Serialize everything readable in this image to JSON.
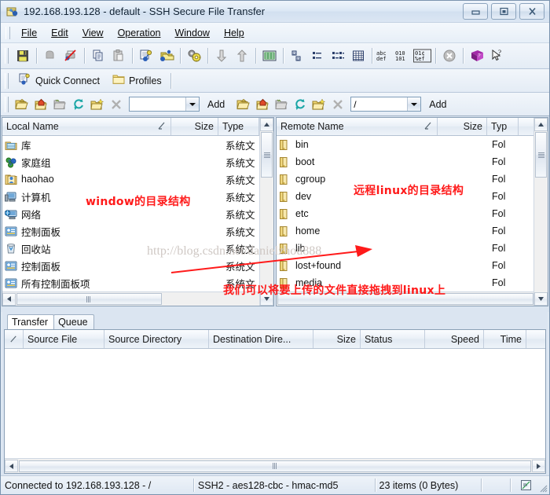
{
  "window": {
    "title": "192.168.193.128 - default - SSH Secure File Transfer",
    "icon": "app-icon",
    "buttons": {
      "minimize": "minimize-icon",
      "maximize": "maximize-icon",
      "close": "close-icon"
    }
  },
  "menu": [
    "File",
    "Edit",
    "View",
    "Operation",
    "Window",
    "Help"
  ],
  "toolbar": {
    "items": [
      {
        "name": "save-icon"
      },
      {
        "name": "print-icon"
      },
      {
        "name": "print-disabled-icon"
      },
      {
        "name": "copy-icon"
      },
      {
        "name": "paste-icon"
      },
      {
        "name": "new-connection-icon"
      },
      {
        "name": "new-file-transfer-icon"
      },
      {
        "name": "settings-icon"
      },
      {
        "name": "download-icon"
      },
      {
        "name": "upload-icon"
      },
      {
        "name": "show-hide-icon"
      },
      {
        "name": "view-large-icons-icon"
      },
      {
        "name": "view-small-icons-icon"
      },
      {
        "name": "view-list-icon"
      },
      {
        "name": "view-details-icon"
      },
      {
        "name": "ascii-transfer-icon"
      },
      {
        "name": "binary-transfer-icon"
      },
      {
        "name": "auto-transfer-icon"
      },
      {
        "name": "disconnect-icon"
      },
      {
        "name": "help-book-icon"
      },
      {
        "name": "context-help-icon"
      }
    ]
  },
  "quickbar": {
    "quick_connect": "Quick Connect",
    "profiles": "Profiles"
  },
  "pathbar": {
    "left": {
      "value": "",
      "placeholder": "",
      "add_label": "Add",
      "buttons": [
        "up-folder-icon",
        "home-folder-icon",
        "back-folder-icon",
        "refresh-icon",
        "new-folder-icon",
        "delete-icon"
      ]
    },
    "right": {
      "value": "/",
      "placeholder": "",
      "add_label": "Add",
      "buttons": [
        "up-folder-icon",
        "home-folder-icon",
        "back-folder-icon",
        "refresh-icon",
        "new-folder-icon",
        "delete-icon"
      ]
    }
  },
  "local_pane": {
    "columns": [
      "Local Name",
      "Size",
      "Type"
    ],
    "sort_indicator": "ascending-sort-icon",
    "rows": [
      {
        "name": "库",
        "size": "",
        "type": "系统文",
        "icon": "library-icon"
      },
      {
        "name": "家庭组",
        "size": "",
        "type": "系统文",
        "icon": "homegroup-icon"
      },
      {
        "name": "haohao",
        "size": "",
        "type": "系统文",
        "icon": "user-folder-icon"
      },
      {
        "name": "计算机",
        "size": "",
        "type": "系统文",
        "icon": "computer-icon"
      },
      {
        "name": "网络",
        "size": "",
        "type": "系统文",
        "icon": "network-icon"
      },
      {
        "name": "控制面板",
        "size": "",
        "type": "系统文",
        "icon": "control-panel-icon"
      },
      {
        "name": "回收站",
        "size": "",
        "type": "系统文",
        "icon": "recycle-bin-icon"
      },
      {
        "name": "控制面板",
        "size": "",
        "type": "系统文",
        "icon": "control-panel-icon"
      },
      {
        "name": "所有控制面板项",
        "size": "",
        "type": "系统文",
        "icon": "control-panel-icon"
      }
    ]
  },
  "remote_pane": {
    "columns": [
      "Remote Name",
      "Size",
      "Typ"
    ],
    "sort_indicator": "ascending-sort-icon",
    "rows": [
      {
        "name": "bin",
        "size": "",
        "type": "Fol",
        "icon": "folder-icon"
      },
      {
        "name": "boot",
        "size": "",
        "type": "Fol",
        "icon": "folder-icon"
      },
      {
        "name": "cgroup",
        "size": "",
        "type": "Fol",
        "icon": "folder-icon"
      },
      {
        "name": "dev",
        "size": "",
        "type": "Fol",
        "icon": "folder-icon"
      },
      {
        "name": "etc",
        "size": "",
        "type": "Fol",
        "icon": "folder-icon"
      },
      {
        "name": "home",
        "size": "",
        "type": "Fol",
        "icon": "folder-icon"
      },
      {
        "name": "lib",
        "size": "",
        "type": "Fol",
        "icon": "folder-icon"
      },
      {
        "name": "lost+found",
        "size": "",
        "type": "Fol",
        "icon": "folder-icon"
      },
      {
        "name": "media",
        "size": "",
        "type": "Fol",
        "icon": "folder-icon"
      }
    ]
  },
  "transfer": {
    "tabs": [
      {
        "label": "Transfer",
        "active": true
      },
      {
        "label": "Queue",
        "active": false
      }
    ],
    "columns": [
      "/",
      "Source File",
      "Source Directory",
      "Destination Dire...",
      "Size",
      "Status",
      "Speed",
      "Time"
    ],
    "rows": []
  },
  "status": {
    "connection": "Connected to 192.168.193.128 - /",
    "cipher": "SSH2 - aes128-cbc - hmac-md5",
    "items": "23 items (0 Bytes)",
    "indicator": "transfer-indicator-icon"
  },
  "annotations": {
    "left_note": "window的目录结构",
    "right_note": "远程linux的目录结构",
    "bottom_note": "我们可以将要上传的文件直接拖拽到linux上",
    "watermark": "http://blog.csdn.net/danielzhou888",
    "color": "#ff1a1a"
  }
}
